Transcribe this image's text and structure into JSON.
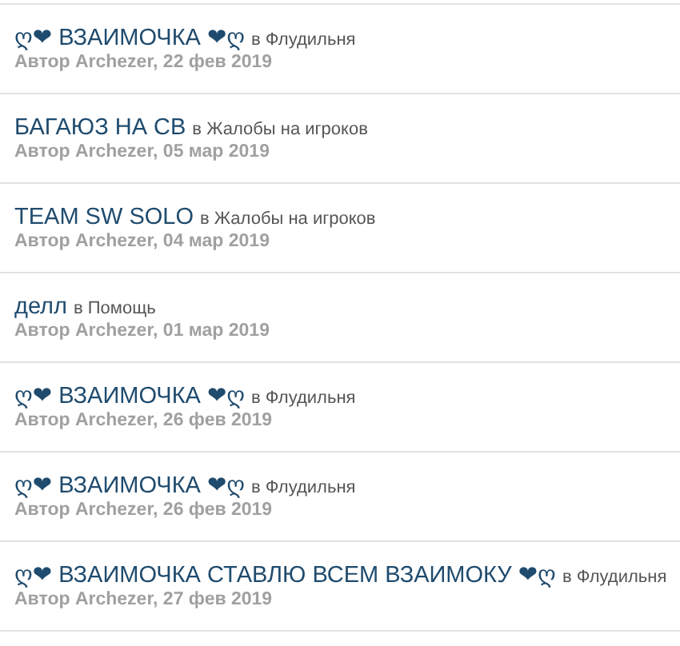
{
  "topics": [
    {
      "title": "ღ❤ ВЗАИМОЧКА ❤ღ",
      "forum": "в Флудильня",
      "meta": "Автор Archezer, 22 фев 2019"
    },
    {
      "title": "БАГАЮЗ НА СВ",
      "forum": "в Жалобы на игроков",
      "meta": "Автор Archezer, 05 мар 2019"
    },
    {
      "title": "TEAM SW SOLO",
      "forum": "в Жалобы на игроков",
      "meta": "Автор Archezer, 04 мар 2019"
    },
    {
      "title": "делл",
      "forum": "в Помощь",
      "meta": "Автор Archezer, 01 мар 2019"
    },
    {
      "title": "ღ❤ ВЗАИМОЧКА ❤ღ",
      "forum": "в Флудильня",
      "meta": "Автор Archezer, 26 фев 2019"
    },
    {
      "title": "ღ❤ ВЗАИМОЧКА ❤ღ",
      "forum": "в Флудильня",
      "meta": "Автор Archezer, 26 фев 2019"
    },
    {
      "title": "ღ❤ ВЗАИМОЧКА СТАВЛЮ ВСЕМ ВЗАИМОКУ ❤ღ",
      "forum": "в Флудильня",
      "meta": "Автор Archezer, 27 фев 2019"
    }
  ]
}
